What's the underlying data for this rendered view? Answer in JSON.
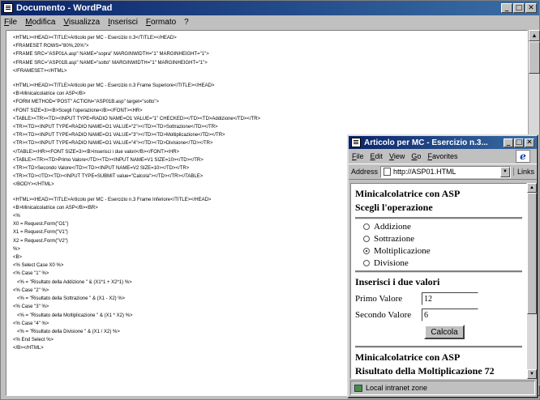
{
  "wordpad": {
    "title": "Documento - WordPad",
    "menu": [
      "File",
      "Modifica",
      "Visualizza",
      "Inserisci",
      "Formato",
      "?"
    ],
    "code_blocks": [
      [
        {
          "text": "<HTML><HEAD><TITLE>Articolo per MC - Esercizio n.3</TITLE></HEAD>",
          "orange": true
        },
        {
          "text": "<FRAMESET ROWS=\"80%,20%\">",
          "orange": false
        },
        {
          "text": "<FRAME SRC=\"ASP01A.asp\" NAME=\"sopra\" MARGINWIDTH=\"1\" MARGINHEIGHT=\"1\">",
          "orange": false
        },
        {
          "text": "<FRAME SRC=\"ASP01B.asp\" NAME=\"sotto\" MARGINWIDTH=\"1\" MARGINHEIGHT=\"1\">",
          "orange": false
        },
        {
          "text": "</FRAMESET></HTML>",
          "orange": false
        }
      ],
      [
        {
          "text": "<HTML><HEAD><TITLE>Articolo per MC - Esercizio n.3 Frame Superiore</TITLE></HEAD>",
          "orange": true
        },
        {
          "text": "<B>Minicalcolatrice con ASP</B>",
          "orange": false
        },
        {
          "text": "<FORM METHOD=\"POST\" ACTION=\"ASP01B.asp\" target=\"sotto\">",
          "orange": false
        },
        {
          "text": "<FONT SIZE=3><B>Scegli l'operazione</B></FONT><HR>",
          "orange": false
        },
        {
          "text": "<TABLE><TR><TD><INPUT TYPE=RADIO NAME=O1 VALUE=\"1\" CHECKED></TD><TD>Addizione</TD></TR>",
          "orange": false
        },
        {
          "text": "<TR><TD><INPUT TYPE=RADIO NAME=O1 VALUE=\"2\"></TD><TD>Sottrazione</TD></TR>",
          "orange": false
        },
        {
          "text": "<TR><TD><INPUT TYPE=RADIO NAME=O1 VALUE=\"3\"></TD><TD>Moltiplicazione</TD></TR>",
          "orange": false
        },
        {
          "text": "<TR><TD><INPUT TYPE=RADIO NAME=O1 VALUE=\"4\"></TD><TD>Divisione</TD></TR>",
          "orange": false
        },
        {
          "text": "</TABLE><HR><FONT SIZE=3><B>Inserisci i due valori</B></FONT><HR>",
          "orange": false
        },
        {
          "text": "<TABLE><TR><TD>Primo Valore</TD><TD><INPUT NAME=V1 SIZE=10></TD></TR>",
          "orange": false
        },
        {
          "text": "<TR><TD>Secondo Valore</TD><TD><INPUT NAME=V2 SIZE=10></TD></TR>",
          "orange": false
        },
        {
          "text": "<TR><TD></TD><TD><INPUT TYPE=SUBMIT value=\"Calcola\"></TD></TR></TABLE>",
          "orange": false
        },
        {
          "text": "</BODY></HTML>",
          "orange": false
        }
      ],
      [
        {
          "text": "<HTML><HEAD><TITLE>Articolo per MC - Esercizio n.3 Frame Inferiore</TITLE></HEAD>",
          "orange": true
        },
        {
          "text": "<B>Minicalcolatrice con ASP</B><BR>",
          "orange": false
        },
        {
          "text": "<%",
          "orange": false
        },
        {
          "text": "X0 = Request.Form(\"O1\")",
          "orange": false
        },
        {
          "text": "X1 = Request.Form(\"V1\")",
          "orange": false
        },
        {
          "text": "X2 = Request.Form(\"V2\")",
          "orange": false
        },
        {
          "text": "%>",
          "orange": false
        },
        {
          "text": "<B>",
          "orange": false
        },
        {
          "text": "<% Select Case X0 %>",
          "orange": false
        },
        {
          "text": "<% Case \"1\" %>",
          "orange": false
        },
        {
          "text": "   <% = \"Risultato della Addizione \" & (X1*1 + X2*1) %>",
          "orange": false
        },
        {
          "text": "<% Case \"2\" %>",
          "orange": false
        },
        {
          "text": "   <% = \"Risultato della Sottrazione \" & (X1 - X2) %>",
          "orange": false
        },
        {
          "text": "<% Case \"3\" %>",
          "orange": false
        },
        {
          "text": "   <% = \"Risultato della Moltiplicazione \" & (X1 * X2) %>",
          "orange": false
        },
        {
          "text": "<% Case \"4\" %>",
          "orange": false
        },
        {
          "text": "   <% = \"Risultato della Divisione \" & (X1 / X2) %>",
          "orange": false
        },
        {
          "text": "<% End Select %>",
          "orange": false
        },
        {
          "text": "</B></HTML>",
          "orange": false
        }
      ]
    ]
  },
  "ie": {
    "title": "Articolo per MC - Esercizio n.3...",
    "menu": [
      "File",
      "Edit",
      "View",
      "Go",
      "Favorites"
    ],
    "address_label": "Address",
    "address_value": "http://ASP01.HTML",
    "links_label": "Links",
    "heading": "Minicalcolatrice con ASP",
    "subheading": "Scegli l'operazione",
    "operations": [
      {
        "label": "Addizione",
        "checked": false
      },
      {
        "label": "Sottrazione",
        "checked": false
      },
      {
        "label": "Moltiplicazione",
        "checked": true
      },
      {
        "label": "Divisione",
        "checked": false
      }
    ],
    "values_heading": "Inserisci i due valori",
    "first_label": "Primo Valore",
    "first_value": "12",
    "second_label": "Secondo Valore",
    "second_value": "6",
    "submit_label": "Calcola",
    "result_heading": "Minicalcolatrice con ASP",
    "result_text": "Risultato della Moltiplicazione 72",
    "status": "Local intranet zone"
  }
}
